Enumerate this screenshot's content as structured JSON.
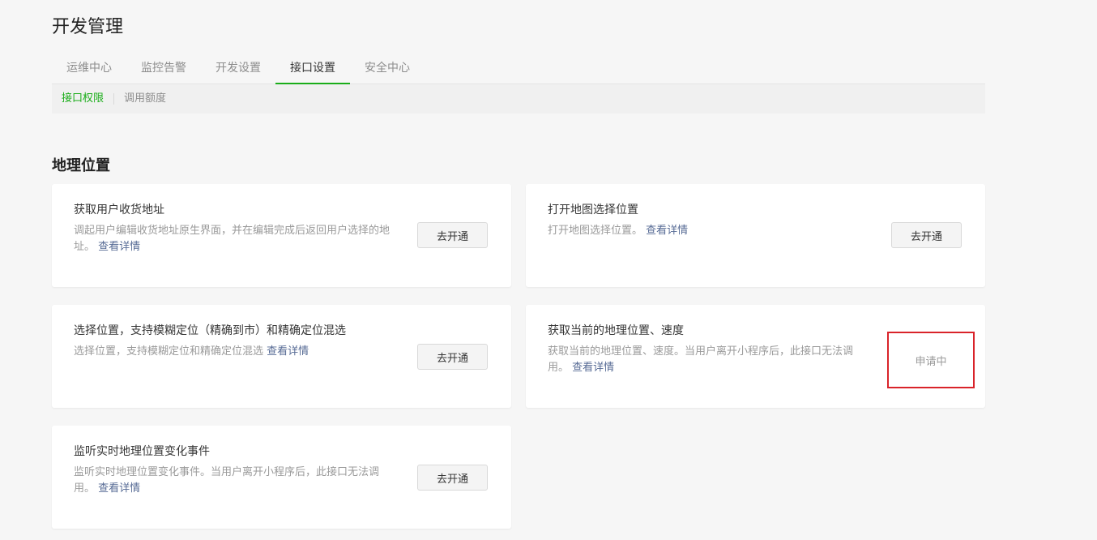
{
  "page": {
    "title": "开发管理"
  },
  "tabs": [
    {
      "label": "运维中心"
    },
    {
      "label": "监控告警"
    },
    {
      "label": "开发设置"
    },
    {
      "label": "接口设置",
      "active": true
    },
    {
      "label": "安全中心"
    }
  ],
  "subnav": [
    {
      "label": "接口权限",
      "active": true
    },
    {
      "label": "调用额度"
    }
  ],
  "section": {
    "title": "地理位置"
  },
  "cards": [
    {
      "title": "获取用户收货地址",
      "desc": "调起用户编辑收货地址原生界面，并在编辑完成后返回用户选择的地址。",
      "link": "查看详情",
      "action": "去开通"
    },
    {
      "title": "打开地图选择位置",
      "desc": "打开地图选择位置。",
      "link": "查看详情",
      "action": "去开通"
    },
    {
      "title": "选择位置，支持模糊定位（精确到市）和精确定位混选",
      "desc": "选择位置，支持模糊定位和精确定位混选",
      "link": "查看详情",
      "action": "去开通"
    },
    {
      "title": "获取当前的地理位置、速度",
      "desc": "获取当前的地理位置、速度。当用户离开小程序后，此接口无法调用。",
      "link": "查看详情",
      "status": "申请中"
    },
    {
      "title": "监听实时地理位置变化事件",
      "desc": "监听实时地理位置变化事件。当用户离开小程序后，此接口无法调用。",
      "link": "查看详情",
      "action": "去开通"
    }
  ],
  "colors": {
    "accent": "#1aad19",
    "link": "#576b95",
    "highlight": "#d9232a"
  }
}
